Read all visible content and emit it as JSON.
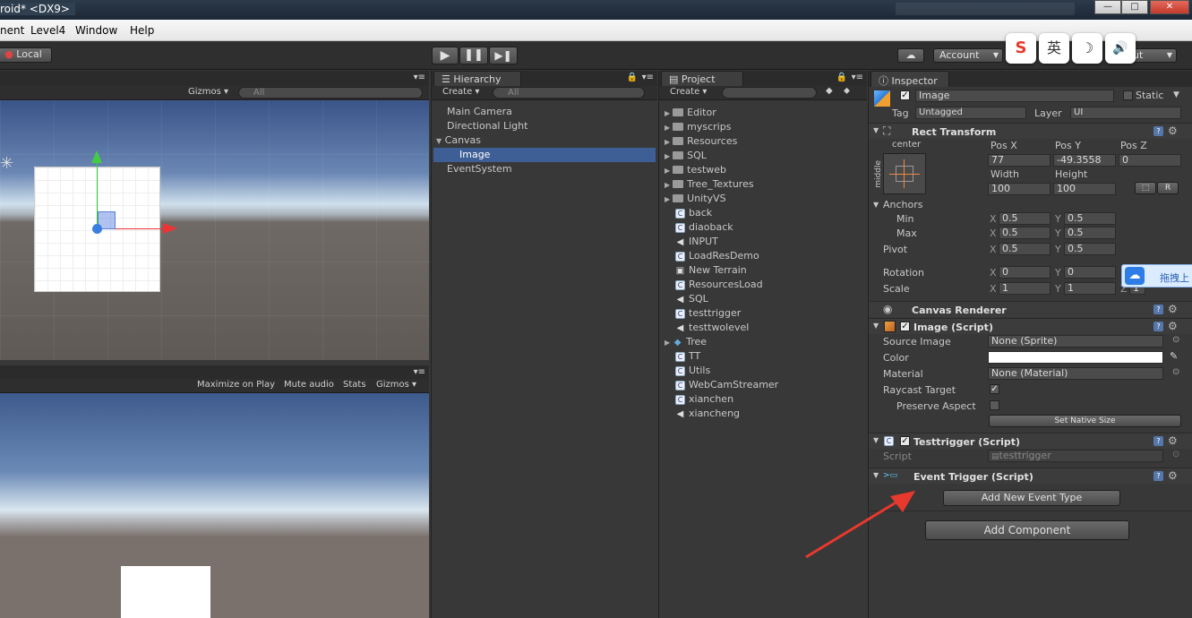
{
  "window": {
    "title": "roid* <DX9>",
    "min": "—",
    "max": "□",
    "close": "✕"
  },
  "menu": [
    "nent",
    "Level4",
    "Window",
    "Help"
  ],
  "toolbar": {
    "local": "Local",
    "account": "Account",
    "layout": "ut"
  },
  "ime": {
    "sogou": "S",
    "lang": "英",
    "moon": "☽",
    "sound": "🔊"
  },
  "scene": {
    "gizmos": "Gizmos ▾",
    "search": "All"
  },
  "game": {
    "maximize": "Maximize on Play",
    "mute": "Mute audio",
    "stats": "Stats",
    "gizmos": "Gizmos ▾"
  },
  "hierarchy": {
    "tab": "Hierarchy",
    "create": "Create ▾",
    "search": "All",
    "items": [
      "Main Camera",
      "Directional Light",
      "Canvas",
      "Image",
      "EventSystem"
    ]
  },
  "project": {
    "tab": "Project",
    "create": "Create ▾",
    "items": [
      {
        "name": "Editor",
        "type": "folder"
      },
      {
        "name": "myscrips",
        "type": "folder"
      },
      {
        "name": "Resources",
        "type": "folder"
      },
      {
        "name": "SQL",
        "type": "folder"
      },
      {
        "name": "testweb",
        "type": "folder"
      },
      {
        "name": "Tree_Textures",
        "type": "folder"
      },
      {
        "name": "UnityVS",
        "type": "folder"
      },
      {
        "name": "back",
        "type": "script"
      },
      {
        "name": "diaoback",
        "type": "script"
      },
      {
        "name": "INPUT",
        "type": "unity"
      },
      {
        "name": "LoadResDemo",
        "type": "script"
      },
      {
        "name": "New Terrain",
        "type": "terrain"
      },
      {
        "name": "ResourcesLoad",
        "type": "script"
      },
      {
        "name": "SQL",
        "type": "unity"
      },
      {
        "name": "testtrigger",
        "type": "script"
      },
      {
        "name": "testtwolevel",
        "type": "unity"
      },
      {
        "name": "Tree",
        "type": "prefab"
      },
      {
        "name": "TT",
        "type": "script"
      },
      {
        "name": "Utils",
        "type": "script"
      },
      {
        "name": "WebCamStreamer",
        "type": "script"
      },
      {
        "name": "xianchen",
        "type": "script"
      },
      {
        "name": "xiancheng",
        "type": "unity"
      }
    ]
  },
  "inspector": {
    "tab": "Inspector",
    "object_name": "Image",
    "static": "Static",
    "tag_label": "Tag",
    "tag_value": "Untagged",
    "layer_label": "Layer",
    "layer_value": "UI",
    "rect": {
      "title": "Rect Transform",
      "anchor_preset": "center",
      "anchor_side": "middle",
      "posx_label": "Pos X",
      "posy_label": "Pos Y",
      "posz_label": "Pos Z",
      "posx": "77",
      "posy": "-49.3558",
      "posz": "0",
      "width_label": "Width",
      "height_label": "Height",
      "width": "100",
      "height": "100",
      "r_btn": "R",
      "anchors": "Anchors",
      "min": "Min",
      "max": "Max",
      "pivot": "Pivot",
      "x": "X",
      "y": "Y",
      "z": "Z",
      "min_x": "0.5",
      "min_y": "0.5",
      "max_x": "0.5",
      "max_y": "0.5",
      "pivot_x": "0.5",
      "pivot_y": "0.5",
      "rotation": "Rotation",
      "rot_x": "0",
      "rot_y": "0",
      "scale": "Scale",
      "scale_x": "1",
      "scale_y": "1",
      "scale_z": "1"
    },
    "canvas_renderer": "Canvas Renderer",
    "image": {
      "title": "Image (Script)",
      "source_label": "Source Image",
      "source_value": "None (Sprite)",
      "color_label": "Color",
      "material_label": "Material",
      "material_value": "None (Material)",
      "raycast_label": "Raycast Target",
      "preserve_label": "Preserve Aspect",
      "native_btn": "Set Native Size"
    },
    "testtrigger": {
      "title": "Testtrigger (Script)",
      "script_label": "Script",
      "script_value": "testtrigger"
    },
    "event_trigger": {
      "title": "Event Trigger (Script)",
      "add_btn": "Add New Event Type"
    },
    "add_component": "Add Component",
    "baidu_popup": "拖拽上"
  },
  "colors": {
    "accent_red": "#e8392e",
    "selection": "#3e5f96",
    "sky_top": "#3c5a8e"
  }
}
